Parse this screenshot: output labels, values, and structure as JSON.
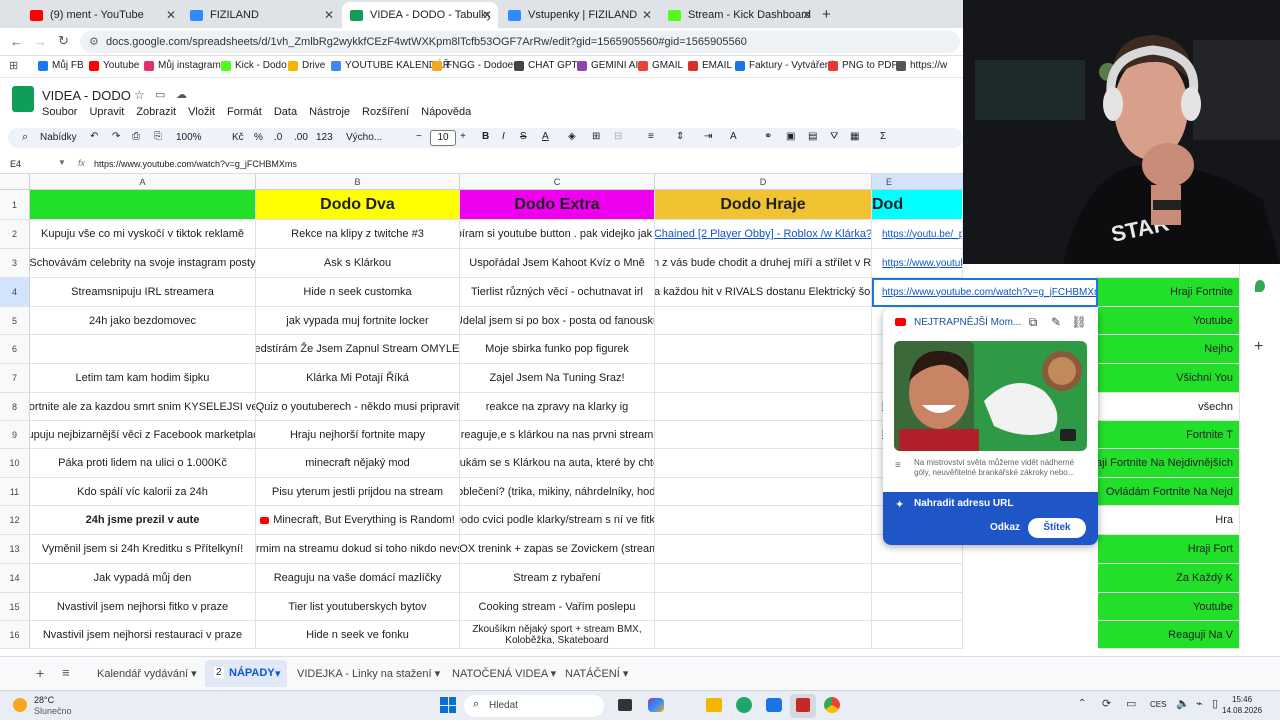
{
  "browser": {
    "tabs": [
      {
        "title": "(9) ment - YouTube",
        "color": "#ff0000"
      },
      {
        "title": "FIZILAND",
        "color": "#2d8cff"
      },
      {
        "title": "VIDEA - DODO - Tabulky Goog",
        "color": "#0f9d58"
      },
      {
        "title": "Vstupenky | FIZILAND",
        "color": "#2d8cff"
      },
      {
        "title": "Stream - Kick Dashboard",
        "color": "#53fc18"
      }
    ],
    "new_tab": "+",
    "url": "docs.google.com/spreadsheets/d/1vh_ZmlbRg2wykkfCEzF4wtWXKpm8lTcfb53OGF7ArRw/edit?gid=1565905560#gid=1565905560",
    "bookmarks": [
      {
        "label": "Můj FB",
        "color": "#1877f2"
      },
      {
        "label": "Youtube",
        "color": "#ff0000"
      },
      {
        "label": "Můj instagram",
        "color": "#e1306c"
      },
      {
        "label": "Kick - Dodo",
        "color": "#53fc18"
      },
      {
        "label": "Drive",
        "color": "#f4b400"
      },
      {
        "label": "YOUTUBE KALENDÁŘ",
        "color": "#4285f4"
      },
      {
        "label": "FNGG - Dodoeu",
        "color": "#f5a623"
      },
      {
        "label": "CHAT GPT",
        "color": "#444444"
      },
      {
        "label": "GEMINI AI",
        "color": "#8e44ad"
      },
      {
        "label": "GMAIL",
        "color": "#ea4335"
      },
      {
        "label": "EMAIL",
        "color": "#d93025"
      },
      {
        "label": "Faktury - Vytváření",
        "color": "#1a73e8"
      },
      {
        "label": "PNG to PDF",
        "color": "#e53935"
      },
      {
        "label": "https://w",
        "color": "#555555"
      }
    ]
  },
  "doc": {
    "title": "VIDEA - DODO",
    "menu": [
      "Soubor",
      "Upravit",
      "Zobrazit",
      "Vložit",
      "Formát",
      "Data",
      "Nástroje",
      "Rozšíření",
      "Nápověda"
    ]
  },
  "toolbar": {
    "search": "Nabídky",
    "zoom": "100%",
    "currency": "Kč",
    "percent": "%",
    "dec_less": ".0",
    "dec_more": ".00",
    "numfmt": "123",
    "font": "Výcho...",
    "fontsize": "10"
  },
  "formula": {
    "cell_ref": "E4",
    "fx": "fx",
    "value": "https://www.youtube.com/watch?v=g_jFCHBMXms"
  },
  "grid": {
    "columns": [
      "A",
      "B",
      "C",
      "D",
      "E"
    ],
    "rows": [
      {
        "n": "1",
        "a": "",
        "b": "Dodo Dva",
        "c": "Dodo Extra",
        "d": "Dodo Hraje",
        "e": "Dod"
      },
      {
        "n": "2",
        "a": "Kupuju vše co mi vyskočí v tiktok reklamě",
        "b": "Rekce na klipy z twitche #3",
        "c": "vybíram si youtube button . pak videjko jak pis",
        "d": "Chained [2 Player Obby] - Roblox /w Klárka?",
        "e": "https://youtu.be/_piP"
      },
      {
        "n": "3",
        "a": "Schovávám celebrity na svoje instagram posty",
        "b": "Ask s Klárkou",
        "c": "Uspořádal Jsem Kahoot Kvíz o Mně",
        "d": "den z vás bude chodit a druhej míří a střílet v Riva",
        "e": "https://www.youtube.com/watch?v=..."
      },
      {
        "n": "4",
        "a": "Streamsnipuju IRL streamera",
        "b": "Hide n seek customka",
        "c": "Tierlist různých věcí - ochutnavat irl",
        "d": "Za každou hit v RIVALS dostanu Elektrický šok!",
        "e": "https://www.youtube.com/watch?v=g_jFCHBMXms"
      },
      {
        "n": "5",
        "a": "24h jako bezdomovec",
        "b": "jak vypada muj fortnite locker",
        "c": "Udelal jsem si po box - posta od fanousku",
        "d": "",
        "e": ""
      },
      {
        "n": "6",
        "a": "",
        "b": "Předstírám Že Jsem Zapnul Stream OMYLEM!",
        "c": "Moje sbirka funko pop figurek",
        "d": "",
        "e": ""
      },
      {
        "n": "7",
        "a": "Letim tam kam hodim šipku",
        "b": "Klárka Mi Potají Říká",
        "c": "Zajel Jsem Na Tuning Sraz!",
        "d": "",
        "e": ""
      },
      {
        "n": "8",
        "a": "Fortnite ale za kazdou smrt snim KYSELEJSI vec",
        "b": "Quiz o youtuberech - někdo musi pripravit",
        "c": "reakce na zpravy na klarky ig",
        "d": "",
        "e": "h"
      },
      {
        "n": "9",
        "a": "Kupuju nejbizarnější věci z Facebook marketplacu",
        "b": "Hraju nejhorší fortnite mapy",
        "c": "reaguje,e s klárkou na nas prvni stream",
        "d": "",
        "e": "h"
      },
      {
        "n": "10",
        "a": "Páka proti lidem na ulici o 1.000Kč",
        "b": "minecraft nějaký mod",
        "c": "Koukám se s Klárkou na auta, které by chtěla",
        "d": "",
        "e": ""
      },
      {
        "n": "11",
        "a": "Kdo spálí víc kalorii za 24h",
        "b": "Pisu yterum jestli prijdou na stream",
        "c": "m za oblečení? (trika, mikiny, náhrdelníky, hodinky..)",
        "d": "",
        "e": ""
      },
      {
        "n": "12",
        "a": "24h jsme prezil v aute",
        "b": "Minecraft, But Everything is Random!",
        "c": "Dodo cvici podle klarky/stream s ní ve fitku",
        "d": "",
        "e": ""
      },
      {
        "n": "13",
        "a": "Vyměnil jsem si 24h Kreditku s Přítelkyní!",
        "b": "ofarmim na streamu dokud si toho nikdo nevsim",
        "c": "BOX trenink + zapas se Zovickem (stream)",
        "d": "",
        "e": ""
      },
      {
        "n": "14",
        "a": "Jak vypadá můj den",
        "b": "Reaguju na vaše domácí mazlíčky",
        "c": "Stream z rybaření",
        "d": "",
        "e": ""
      },
      {
        "n": "15",
        "a": "Nvastivil jsem nejhorsi fitko v praze",
        "b": "Tier list youtuberskych bytov",
        "c": "Cooking stream - Vařím poslepu",
        "d": "",
        "e": ""
      },
      {
        "n": "16",
        "a": "Nvastivil jsem nejhorsi restauraci v praze",
        "b": "Hide n seek ve fonku",
        "c": "Zkoušíkm nějaký sport + stream BMX, Koloběžka, Skateboard",
        "d": "",
        "e": ""
      }
    ],
    "right_col": [
      "",
      "",
      "",
      "Hraji Fortnite",
      "Youtube",
      "Nejho",
      "Všichni You",
      "všechn",
      "Fortnite T",
      "Hraji Fortnite Na Nejdivnějších",
      "Ovládám Fortnite Na Nejd",
      "Hra",
      "Hraji Fort",
      "Za Každý K",
      "Youtube",
      "Reaguji Na V"
    ],
    "header_colors": {
      "a": "#22e02a",
      "b": "#ffff00",
      "c": "#ee00ee",
      "d": "#f1c232",
      "e": "#00ffff"
    }
  },
  "popup": {
    "title": "NEJTRAPNĚJŠÍ Mom...",
    "description": "Na mistrovství světa můžeme vidět nádherné góly, neuvěřitelné brankářské zákroky nebo...",
    "replace_url": "Nahradit adresu URL",
    "dismiss": "Odkaz",
    "chip": "Štítek"
  },
  "sheet_tabs": {
    "tabs": [
      "Kalendář vydávání",
      "NÁPADY",
      "VIDEJKA - Linky na stažení",
      "NATOČENÁ VIDEA",
      "NATÁČENÍ"
    ],
    "active_badge": "2"
  },
  "taskbar": {
    "temp": "28°C",
    "weather": "Slunečno",
    "search": "Hledat",
    "lang": "CES",
    "time": "15:46",
    "date": "14.08.2026"
  }
}
